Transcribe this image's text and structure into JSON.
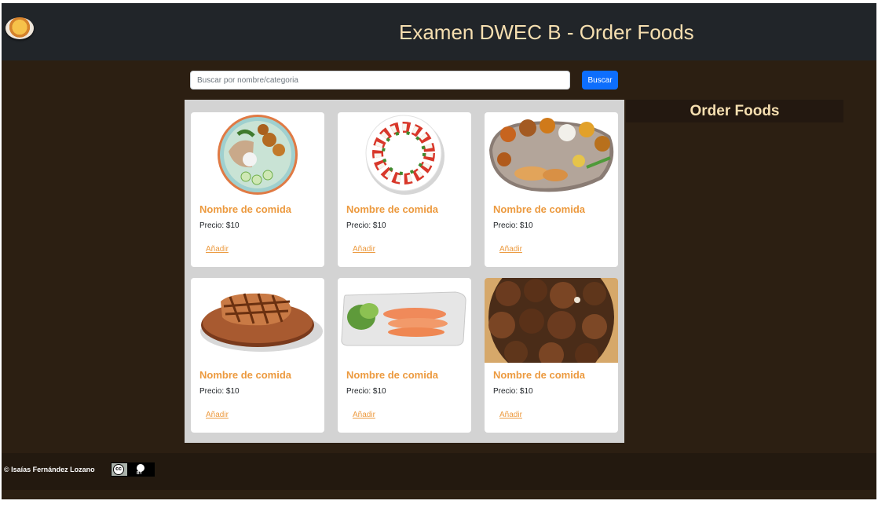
{
  "header": {
    "title": "Examen DWEC B - Order Foods",
    "logo": "food-bowl-logo"
  },
  "search": {
    "placeholder": "Buscar por nombre/categoria",
    "value": "",
    "button_label": "Buscar"
  },
  "foods": [
    {
      "name": "Nombre de comida",
      "price": "Precio: $10",
      "add_label": "Añadir",
      "image": "poke-bowl"
    },
    {
      "name": "Nombre de comida",
      "price": "Precio: $10",
      "add_label": "Añadir",
      "image": "caprese-plate"
    },
    {
      "name": "Nombre de comida",
      "price": "Precio: $10",
      "add_label": "Añadir",
      "image": "thali-platter"
    },
    {
      "name": "Nombre de comida",
      "price": "Precio: $10",
      "add_label": "Añadir",
      "image": "grilled-steak"
    },
    {
      "name": "Nombre de comida",
      "price": "Precio: $10",
      "add_label": "Añadir",
      "image": "salmon-carpaccio"
    },
    {
      "name": "Nombre de comida",
      "price": "Precio: $10",
      "add_label": "Añadir",
      "image": "fried-meat"
    }
  ],
  "order": {
    "title": "Order Foods"
  },
  "footer": {
    "copyright": "© Isaías Fernández Lozano",
    "license": "CC BY"
  },
  "colors": {
    "header_bg": "#212529",
    "page_bg": "#2c1f12",
    "accent": "#ec9a3f",
    "title": "#f6dfb0",
    "button": "#0d6efd"
  }
}
